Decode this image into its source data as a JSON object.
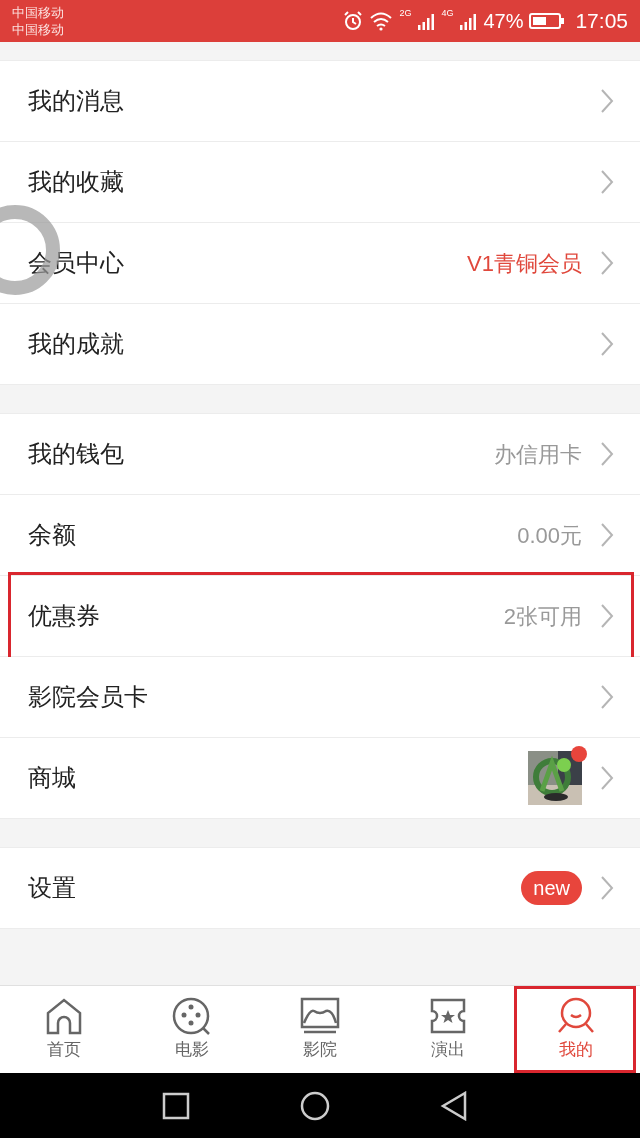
{
  "status_bar": {
    "carriers": [
      "中国移动",
      "中国移动"
    ],
    "network_1": "2G",
    "network_2": "4G",
    "battery": "47%",
    "time": "17:05"
  },
  "sections": [
    {
      "items": [
        {
          "label": "我的消息",
          "kind": "plain",
          "highlighted": false
        },
        {
          "label": "我的收藏",
          "kind": "plain",
          "highlighted": false
        },
        {
          "label": "会员中心",
          "kind": "accent",
          "value": "V1青铜会员",
          "highlighted": false
        },
        {
          "label": "我的成就",
          "kind": "plain",
          "highlighted": false
        }
      ]
    },
    {
      "items": [
        {
          "label": "我的钱包",
          "kind": "text",
          "value": "办信用卡",
          "highlighted": false
        },
        {
          "label": "余额",
          "kind": "text",
          "value": "0.00元",
          "highlighted": false
        },
        {
          "label": "优惠券",
          "kind": "text",
          "value": "2张可用",
          "highlighted": true
        },
        {
          "label": "影院会员卡",
          "kind": "plain",
          "highlighted": false
        },
        {
          "label": "商城",
          "kind": "picture",
          "highlighted": false
        }
      ]
    },
    {
      "items": [
        {
          "label": "设置",
          "kind": "badge",
          "value": "new",
          "highlighted": false
        }
      ]
    }
  ],
  "tab_bar": [
    {
      "label": "首页",
      "kind": "home",
      "selected": false,
      "highlighted": false
    },
    {
      "label": "电影",
      "kind": "film",
      "selected": false,
      "highlighted": false
    },
    {
      "label": "影院",
      "kind": "cinema",
      "selected": false,
      "highlighted": false
    },
    {
      "label": "演出",
      "kind": "ticket",
      "selected": false,
      "highlighted": false
    },
    {
      "label": "我的",
      "kind": "me",
      "selected": true,
      "highlighted": true
    }
  ]
}
